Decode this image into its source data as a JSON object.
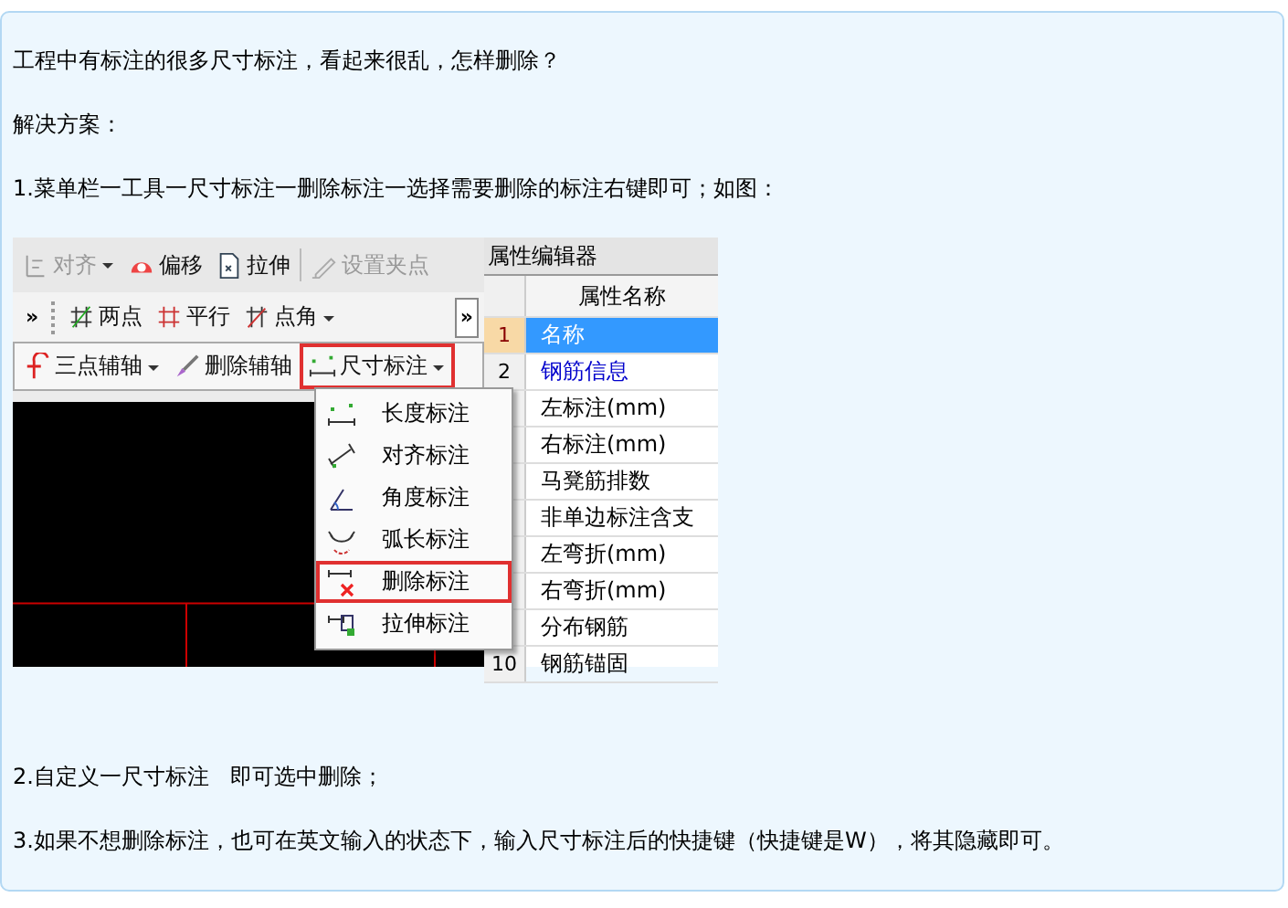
{
  "question": "工程中有标注的很多尺寸标注，看起来很乱，怎样删除？",
  "solution_label": "解决方案：",
  "step_1": "1.菜单栏一工具一尺寸标注一删除标注一选择需要删除的标注右键即可；如图：",
  "screenshot": {
    "toolbar_rows": [
      [
        {
          "kind": "button",
          "label": "对齐",
          "dropdown": true,
          "disabled": true
        },
        {
          "kind": "button",
          "label": "偏移",
          "dropdown": false,
          "disabled": false
        },
        {
          "kind": "button",
          "label": "拉伸",
          "dropdown": false,
          "disabled": false
        },
        {
          "kind": "separator"
        },
        {
          "kind": "button",
          "label": "设置夹点",
          "dropdown": false,
          "disabled": true
        }
      ],
      [
        {
          "kind": "overflow",
          "label": "»"
        },
        {
          "kind": "button",
          "label": "两点",
          "dropdown": false,
          "disabled": false
        },
        {
          "kind": "button",
          "label": "平行",
          "dropdown": false,
          "disabled": false
        },
        {
          "kind": "button",
          "label": "点角",
          "dropdown": true,
          "disabled": false
        },
        {
          "kind": "chevron",
          "label": "»"
        }
      ],
      [
        {
          "kind": "button",
          "label": "三点辅轴",
          "dropdown": true,
          "disabled": false,
          "highlighted": false
        },
        {
          "kind": "button",
          "label": "删除辅轴",
          "dropdown": false,
          "disabled": false,
          "highlighted": false
        },
        {
          "kind": "button",
          "label": "尺寸标注",
          "dropdown": true,
          "disabled": false,
          "highlighted": true
        }
      ]
    ],
    "menu": [
      {
        "label": "长度标注",
        "highlighted": false
      },
      {
        "label": "对齐标注",
        "highlighted": false
      },
      {
        "label": "角度标注",
        "highlighted": false
      },
      {
        "label": "弧长标注",
        "highlighted": false
      },
      {
        "label": "删除标注",
        "highlighted": true
      },
      {
        "label": "拉伸标注",
        "highlighted": false
      }
    ],
    "property_editor": {
      "title": "属性编辑器",
      "column": "属性名称",
      "rows": [
        {
          "number": "1",
          "name": "名称",
          "selected": true,
          "link": false
        },
        {
          "number": "2",
          "name": "钢筋信息",
          "selected": false,
          "link": true
        },
        {
          "name": "左标注(mm)",
          "selected": false,
          "link": false
        },
        {
          "name": "右标注(mm)",
          "selected": false,
          "link": false
        },
        {
          "name": "马凳筋排数",
          "selected": false,
          "link": false
        },
        {
          "name": "非单边标注含支",
          "selected": false,
          "link": false
        },
        {
          "name": "左弯折(mm)",
          "selected": false,
          "link": false
        },
        {
          "name": "右弯折(mm)",
          "selected": false,
          "link": false
        },
        {
          "name": "分布钢筋",
          "selected": false,
          "link": false
        },
        {
          "number": "10",
          "name": "钢筋锚固",
          "selected": false,
          "link": false
        }
      ]
    }
  },
  "step_2": "2.自定义一尺寸标注   即可选中删除；",
  "step_3": "3.如果不想删除标注，也可在英文输入的状态下，输入尺寸标注后的快捷键（快捷键是W），将其隐藏即可。"
}
